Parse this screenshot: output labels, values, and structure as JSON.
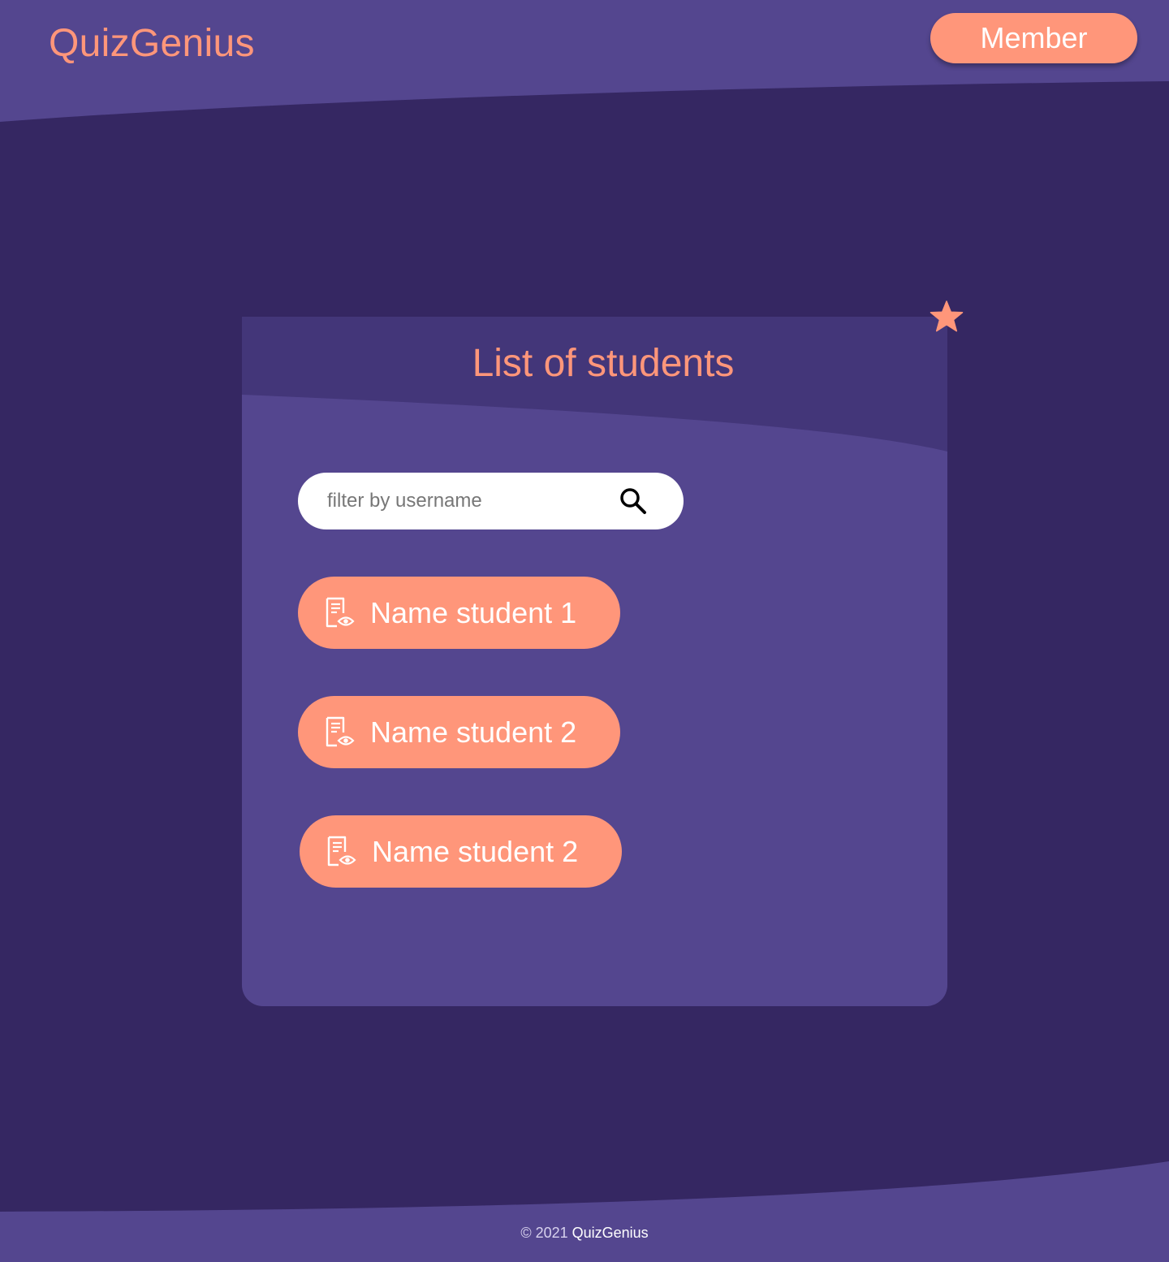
{
  "app": {
    "brand": "QuizGenius"
  },
  "header": {
    "member_label": "Member"
  },
  "card": {
    "title": "List of students",
    "badge_icon": "star-icon"
  },
  "search": {
    "placeholder": "filter by username",
    "value": "",
    "icon": "search-icon"
  },
  "students": [
    {
      "label": "Name student 1",
      "icon": "document-view-icon"
    },
    {
      "label": "Name student 2",
      "icon": "document-view-icon"
    },
    {
      "label": "Name student 2",
      "icon": "document-view-icon"
    }
  ],
  "footer": {
    "copyright": "© 2021",
    "brand": "QuizGenius"
  },
  "colors": {
    "accent": "#FF967A",
    "background": "#352762",
    "header": "#54468F",
    "card": "#54468F",
    "card_header": "#433679",
    "white": "#FFFFFF"
  }
}
